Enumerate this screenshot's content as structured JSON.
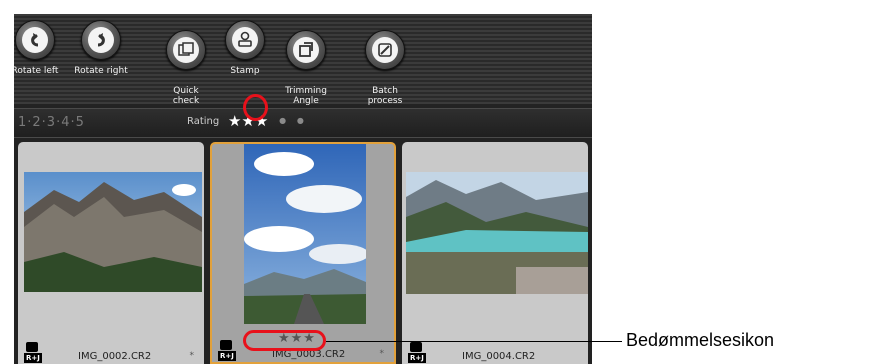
{
  "toolbar": {
    "buttons": [
      {
        "label": "Rotate left",
        "icon": "rotate-left-icon"
      },
      {
        "label": "Rotate right",
        "icon": "rotate-right-icon"
      },
      {
        "label": "Quick\ncheck",
        "icon": "quick-check-icon"
      },
      {
        "label": "Stamp",
        "icon": "stamp-icon"
      },
      {
        "label": "Trimming\nAngle",
        "icon": "trimming-angle-icon"
      },
      {
        "label": "Batch\nprocess",
        "icon": "batch-process-icon"
      }
    ]
  },
  "rating_bar": {
    "numbers": "1·2·3·4·5",
    "label": "Rating",
    "stars": "★★★",
    "current_rating": 3
  },
  "thumbnails": [
    {
      "filename": "IMG_0002.CR2",
      "badge": "R+J",
      "mark": "*"
    },
    {
      "filename": "IMG_0003.CR2",
      "badge": "R+J",
      "mark": "*",
      "stars": "★★★",
      "selected": true
    },
    {
      "filename": "IMG_0004.CR2",
      "badge": "R+J",
      "mark": ""
    }
  ],
  "callout": {
    "text": "Bedømmelsesikon"
  },
  "colors": {
    "highlight": "#e8111b",
    "selection_border": "#e2a13b"
  }
}
